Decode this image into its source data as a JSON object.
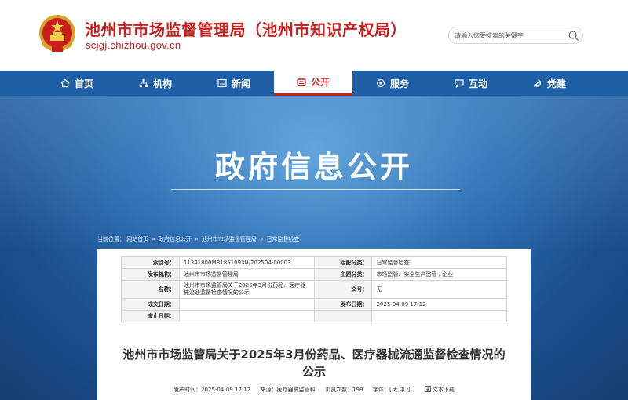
{
  "header": {
    "site_title": "池州市市场监督管理局（池州市知识产权局）",
    "site_domain": "scjgj.chizhou.gov.cn",
    "emblem_icon": "national-emblem-icon",
    "search_placeholder": "请输入您要搜索的关键字",
    "search_icon": "search-icon"
  },
  "nav": {
    "items": [
      {
        "label": "首页",
        "icon": "home-icon"
      },
      {
        "label": "机构",
        "icon": "org-chart-icon"
      },
      {
        "label": "新闻",
        "icon": "news-icon"
      },
      {
        "label": "公开",
        "icon": "document-icon",
        "active": true
      },
      {
        "label": "服务",
        "icon": "service-icon"
      },
      {
        "label": "互动",
        "icon": "chat-icon"
      },
      {
        "label": "党建",
        "icon": "party-emblem-icon"
      }
    ],
    "active_color": "#c81e1e",
    "bar_color": "#1f5fa6"
  },
  "banner": {
    "title": "政府信息公开"
  },
  "breadcrumb": {
    "prefix": "当前位置：",
    "items": [
      "网站首页",
      "政府信息公开",
      "池州市市场监督管理局",
      "日常监督检查"
    ],
    "separator": "»"
  },
  "meta": {
    "index_no_label": "索引号：",
    "index_no": "11341800MB1851093N/202504-00003",
    "category_label": "组配分类：",
    "category": "日常监督检查",
    "publisher_label": "发布机构：",
    "publisher": "池州市市场监督管理局",
    "topic_label": "主题分类：",
    "topic": "市场监管、安全生产监管 / 企业",
    "name_label": "名称：",
    "name": "池州市市场监管局关于2025年3月份药品、医疗器械流通监督检查情况的公示",
    "doc_no_label": "文号：",
    "doc_no": "无",
    "created_label": "成文日期：",
    "created": "",
    "pubdate_label": "发布日期：",
    "pubdate": "2025-04-09 17:12",
    "expiry_label": "废止日期：",
    "expiry": ""
  },
  "document": {
    "title": "池州市市场监管局关于2025年3月份药品、医疗器械流通监督检查情况的公示",
    "published_label": "发布时间：",
    "published": "2025-04-09 17:12",
    "source_label": "来源：",
    "source": "医疗器械监管科",
    "views_label": "浏览次数：",
    "views": "199",
    "font_label": "字体：",
    "font_open": "[",
    "font_large": "大",
    "font_medium": "中",
    "font_small": "小",
    "font_close": "]",
    "download_label": "文本下载",
    "download_icon": "download-icon"
  }
}
